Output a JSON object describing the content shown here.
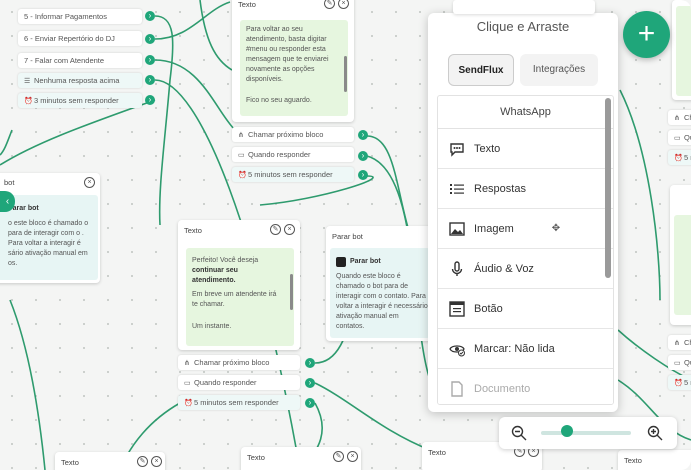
{
  "canvas": {
    "top_left_items": [
      {
        "label": "5 - Informar Pagamentos",
        "icon": ""
      },
      {
        "label": "6 - Enviar Repertório do DJ",
        "icon": ""
      },
      {
        "label": "7 - Falar com Atendente",
        "icon": ""
      },
      {
        "label": "Nenhuma resposta acima",
        "icon": "menu-icon"
      },
      {
        "label": "3 minutos sem responder",
        "icon": "alarm-icon"
      }
    ],
    "top_node": {
      "header": "Texto",
      "message": "Para voltar ao seu atendimento, basta digitar #menu ou responder esta mensagem que te enviarei novamente as opções disponíveis.",
      "message2": "Fico no seu aguardo.",
      "items": [
        "Chamar próximo bloco",
        "Quando responder",
        "5 minutos sem responder"
      ]
    },
    "left_node": {
      "header": "bot",
      "title": "Parar bot",
      "text": "o este bloco é chamado o para de interagir com o . Para voltar a interagir é sário ativação manual em os."
    },
    "mid_node": {
      "header": "Texto",
      "message_a": "Perfeito! Você deseja",
      "message_b": "continuar seu atendimento.",
      "message2": "Em breve um atendente irá te chamar.",
      "message3": "Um instante.",
      "items": [
        "Chamar próximo bloco",
        "Quando responder",
        "5 minutos sem responder"
      ]
    },
    "stop_node": {
      "header": "Parar bot",
      "title": "Parar bot",
      "text": "Quando este bloco é chamado o bot para de interagir com o contato. Para voltar a interagir é necessário ativação manual em contatos."
    },
    "right_items": [
      "Ch",
      "Qu",
      "5 n"
    ],
    "right_items2": [
      "Ch",
      "Qu",
      "5 m"
    ],
    "bottom_headers": [
      "Texto",
      "Texto",
      "Texto",
      "Texto"
    ]
  },
  "panel": {
    "title": "Clique e Arraste",
    "tabs": [
      "SendFlux",
      "Integrações"
    ],
    "list_header": "WhatsApp",
    "items": [
      {
        "label": "Texto",
        "icon": "chat-bubble-icon"
      },
      {
        "label": "Respostas",
        "icon": "list-icon"
      },
      {
        "label": "Imagem",
        "icon": "image-icon"
      },
      {
        "label": "Áudio & Voz",
        "icon": "microphone-icon"
      },
      {
        "label": "Botão",
        "icon": "button-icon"
      },
      {
        "label": "Marcar: Não lida",
        "icon": "eye-check-icon"
      },
      {
        "label": "Documento",
        "icon": "document-icon"
      }
    ]
  },
  "fab": {
    "symbol": "+"
  },
  "colors": {
    "accent": "#1fa67a",
    "node_message_bg": "#e6f6df",
    "canvas_bg": "#f4f5f4"
  }
}
